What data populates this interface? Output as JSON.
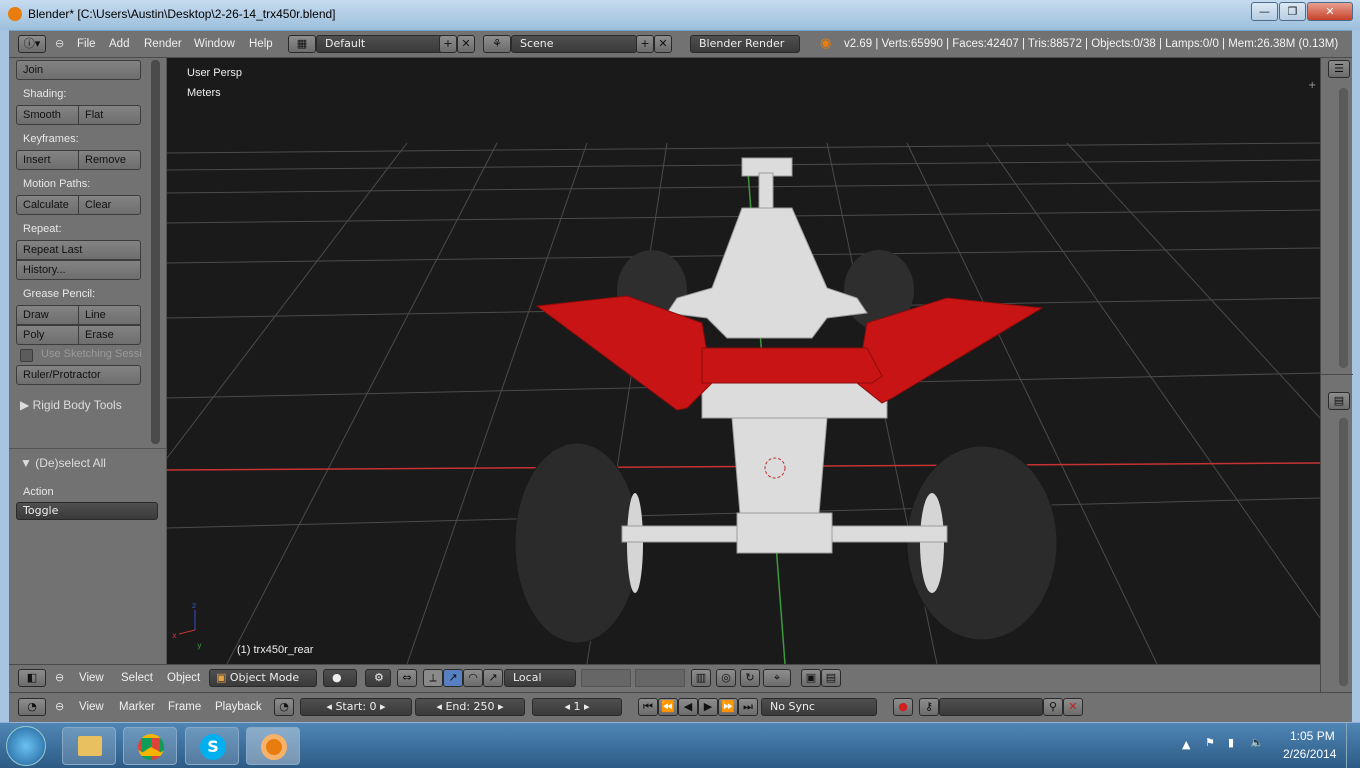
{
  "window": {
    "title": "Blender* [C:\\Users\\Austin\\Desktop\\2-26-14_trx450r.blend]",
    "minimize": "—",
    "maximize": "❐",
    "close": "✕"
  },
  "topbar": {
    "menus": [
      "File",
      "Add",
      "Render",
      "Window",
      "Help"
    ],
    "layout": "Default",
    "scene": "Scene",
    "engine": "Blender Render",
    "stats": "v2.69 | Verts:65990 | Faces:42407 | Tris:88572 | Objects:0/38 | Lamps:0/0 | Mem:26.38M (0.13M)"
  },
  "toolshelf": {
    "join": "Join",
    "shading_label": "Shading:",
    "smooth": "Smooth",
    "flat": "Flat",
    "keyframes_label": "Keyframes:",
    "insert": "Insert",
    "remove": "Remove",
    "motion_label": "Motion Paths:",
    "calculate": "Calculate",
    "clear": "Clear",
    "repeat_label": "Repeat:",
    "repeat_last": "Repeat Last",
    "history": "History...",
    "grease_label": "Grease Pencil:",
    "draw": "Draw",
    "line": "Line",
    "poly": "Poly",
    "erase": "Erase",
    "sketching": "Use Sketching Sessi",
    "ruler": "Ruler/Protractor",
    "rigid": "Rigid Body Tools",
    "op_panel": "(De)select All",
    "action_label": "Action",
    "action_value": "Toggle"
  },
  "viewport": {
    "view_name": "User Persp",
    "units": "Meters",
    "object_name": "(1) trx450r_rear"
  },
  "bar3d": {
    "menus": [
      "View",
      "Select",
      "Object"
    ],
    "mode": "Object Mode",
    "orientation": "Local"
  },
  "timeline": {
    "menus": [
      "View",
      "Marker",
      "Frame",
      "Playback"
    ],
    "start": "Start: 0",
    "end": "End: 250",
    "current": "1",
    "sync": "No Sync"
  },
  "taskbar": {
    "time": "1:05 PM",
    "date": "2/26/2014"
  },
  "colors": {
    "ui_gray": "#727272",
    "viewport_bg": "#393939",
    "fender_red": "#c81414",
    "x_axis": "#c83232",
    "y_axis": "#3c9a3c"
  }
}
